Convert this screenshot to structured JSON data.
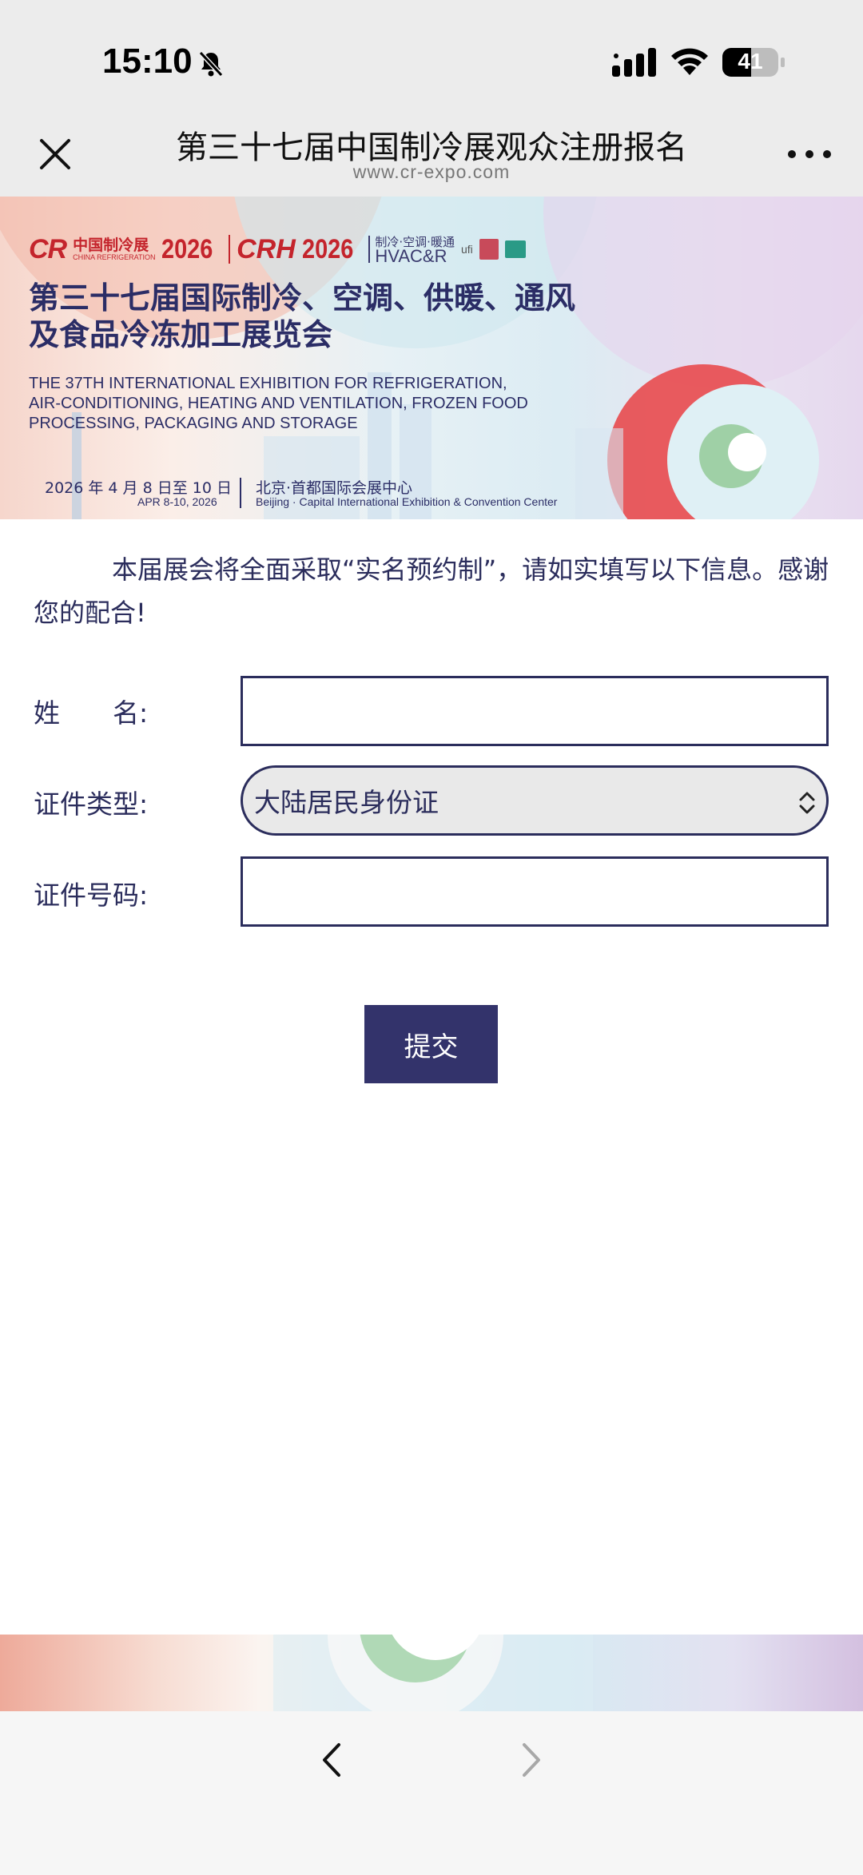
{
  "status_bar": {
    "time": "15:10",
    "battery": "41"
  },
  "nav": {
    "title": "第三十七届中国制冷展观众注册报名",
    "url": "www.cr-expo.com"
  },
  "banner": {
    "logo_cr": "CR",
    "logo_cr_name": "中国制冷展",
    "logo_cr_sub": "CHINA REFRIGERATION",
    "logo_year_1": "2026",
    "logo_crh": "CRH",
    "logo_year_2": "2026",
    "logo_hvac_cn": "制冷·空调·暖通",
    "logo_hvac_en": "HVAC&R",
    "logo_ufi": "ufi",
    "title_cn_line1": "第三十七届国际制冷、空调、供暖、通风",
    "title_cn_line2": "及食品冷冻加工展览会",
    "title_en_line1": "THE 37TH INTERNATIONAL EXHIBITION FOR REFRIGERATION,",
    "title_en_line2": "AIR-CONDITIONING, HEATING AND VENTILATION, FROZEN FOOD",
    "title_en_line3": "PROCESSING, PACKAGING AND STORAGE",
    "date_cn": "2026 年 4 月 8 日至 10 日",
    "date_en": "APR 8-10, 2026",
    "venue_cn": "北京·首都国际会展中心",
    "venue_en": "Beijing · Capital International Exhibition & Convention Center"
  },
  "notice": "本届展会将全面采取“实名预约制”，请如实填写以下信息。感谢您的配合!",
  "form": {
    "name_label": "姓　　名:",
    "name_value": "",
    "id_type_label": "证件类型:",
    "id_type_value": "大陆居民身份证",
    "id_number_label": "证件号码:",
    "id_number_value": ""
  },
  "submit_label": "提交",
  "colors": {
    "primary": "#33336b",
    "text": "#2b2d5c",
    "logo_red": "#c4242c",
    "bar_bg": "#ececec"
  },
  "icons": {
    "close": "close-icon",
    "more": "more-icon",
    "back": "chevron-left-icon",
    "forward": "chevron-right-icon",
    "silent": "bell-slash-icon"
  }
}
